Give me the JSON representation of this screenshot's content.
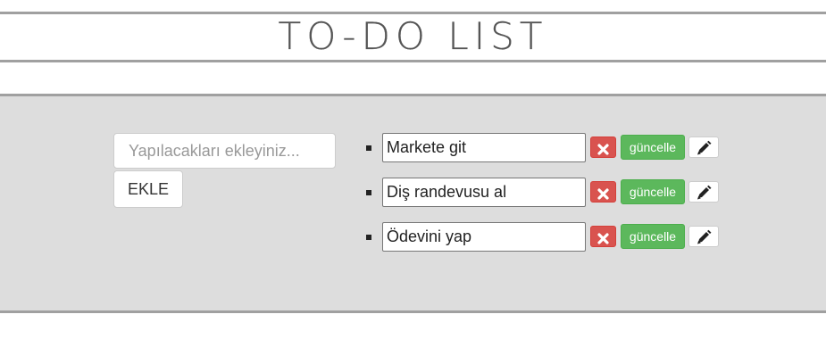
{
  "header": {
    "title": "TO-DO LIST"
  },
  "form": {
    "input_placeholder": "Yapılacakları ekleyiniz...",
    "input_value": "",
    "add_label": "EKLE"
  },
  "todos": [
    {
      "text": "Markete git",
      "update_label": "güncelle"
    },
    {
      "text": "Diş randevusu al",
      "update_label": "güncelle"
    },
    {
      "text": "Ödevini yap",
      "update_label": "güncelle"
    }
  ],
  "icons": {
    "delete": "close-icon",
    "edit": "pencil-icon"
  },
  "colors": {
    "panel_background": "#dddddd",
    "rule": "#a0a0a0",
    "delete": "#d9534f",
    "update": "#5cb85c",
    "title": "#555555"
  }
}
